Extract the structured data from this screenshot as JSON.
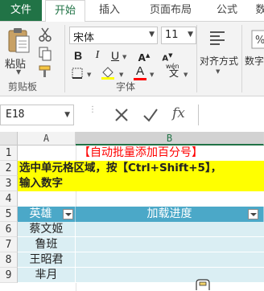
{
  "ribbon_tabs": {
    "file": "文件",
    "home": "开始",
    "insert": "插入",
    "page_layout": "页面布局",
    "formulas": "公式",
    "more": "数"
  },
  "clipboard": {
    "paste_label": "粘贴",
    "group_label": "剪贴板"
  },
  "font": {
    "name": "宋体",
    "size": "11",
    "group_label": "字体",
    "font_color": "#ff0000"
  },
  "alignment": {
    "label": "对齐方式"
  },
  "number": {
    "label": "数字"
  },
  "formula_bar": {
    "name_box": "E18"
  },
  "sheet": {
    "columns": [
      "A",
      "B"
    ],
    "rows": [
      "1",
      "2",
      "3",
      "4",
      "5",
      "6",
      "7",
      "8",
      "9"
    ],
    "title": "【自动批量添加百分号】",
    "instruction_line1": "选中单元格区域，按【Ctrl+Shift+5】，",
    "instruction_line2": "输入数字",
    "table_header_a": "英雄",
    "table_header_b": "加载进度",
    "heroes": [
      "蔡文姬",
      "鲁班",
      "王昭君",
      "芈月"
    ]
  },
  "colors": {
    "accent": "#217346",
    "table_header": "#4ba8c8",
    "table_band": "#daeef3",
    "highlight": "#ffff00"
  }
}
